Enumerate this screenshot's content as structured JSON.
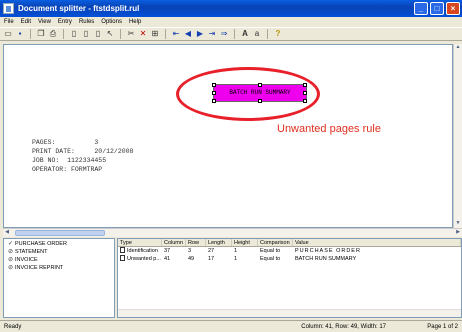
{
  "window": {
    "title": "Document splitter - ftstdsplit.rul"
  },
  "menu": [
    "File",
    "Edit",
    "View",
    "Entry",
    "Rules",
    "Options",
    "Help"
  ],
  "toolbar": {
    "icons": [
      "new-icon",
      "save-icon",
      "copy-icon",
      "print-icon",
      "page-icon",
      "page2-icon",
      "page3-icon",
      "pointer-icon",
      "cut-icon",
      "delete-icon",
      "grid-icon",
      "first-icon",
      "prev-icon",
      "next-icon",
      "last-icon",
      "fast-forward-icon",
      "font-larger-icon",
      "font-smaller-icon",
      "help-icon"
    ]
  },
  "document": {
    "highlight_text": "BATCH RUN SUMMARY",
    "annotation": "Unwanted pages rule",
    "record_lines": [
      "PAGES:          3",
      "PRINT DATE:     20/12/2008",
      "JOB NO:  1122334455",
      "OPERATOR: FORMTRAP"
    ]
  },
  "tree": {
    "items": [
      {
        "mark": "✓",
        "label": "PURCHASE ORDER"
      },
      {
        "mark": "⊘",
        "label": "STATEMENT"
      },
      {
        "mark": "⊘",
        "label": "INVOICE"
      },
      {
        "mark": "⊘",
        "label": "INVOICE REPRINT"
      }
    ]
  },
  "table": {
    "headers": [
      "Type",
      "Column",
      "Row",
      "Length",
      "Height",
      "Comparison",
      "Value"
    ],
    "rows": [
      {
        "type": "Identification",
        "column": "37",
        "row": "3",
        "length": "27",
        "height": "1",
        "comparison": "Equal to",
        "value": "PURCHASE ORDER"
      },
      {
        "type": "Unwanted p...",
        "column": "41",
        "row": "49",
        "length": "17",
        "height": "1",
        "comparison": "Equal to",
        "value": "BATCH RUN SUMMARY"
      }
    ]
  },
  "status": {
    "left": "Ready",
    "position": "Column: 41, Row: 49, Width: 17",
    "page": "Page 1 of 2"
  },
  "colors": {
    "highlight": "#ee00ee",
    "annotation": "#e03020",
    "titlebar": "#0842b6"
  }
}
